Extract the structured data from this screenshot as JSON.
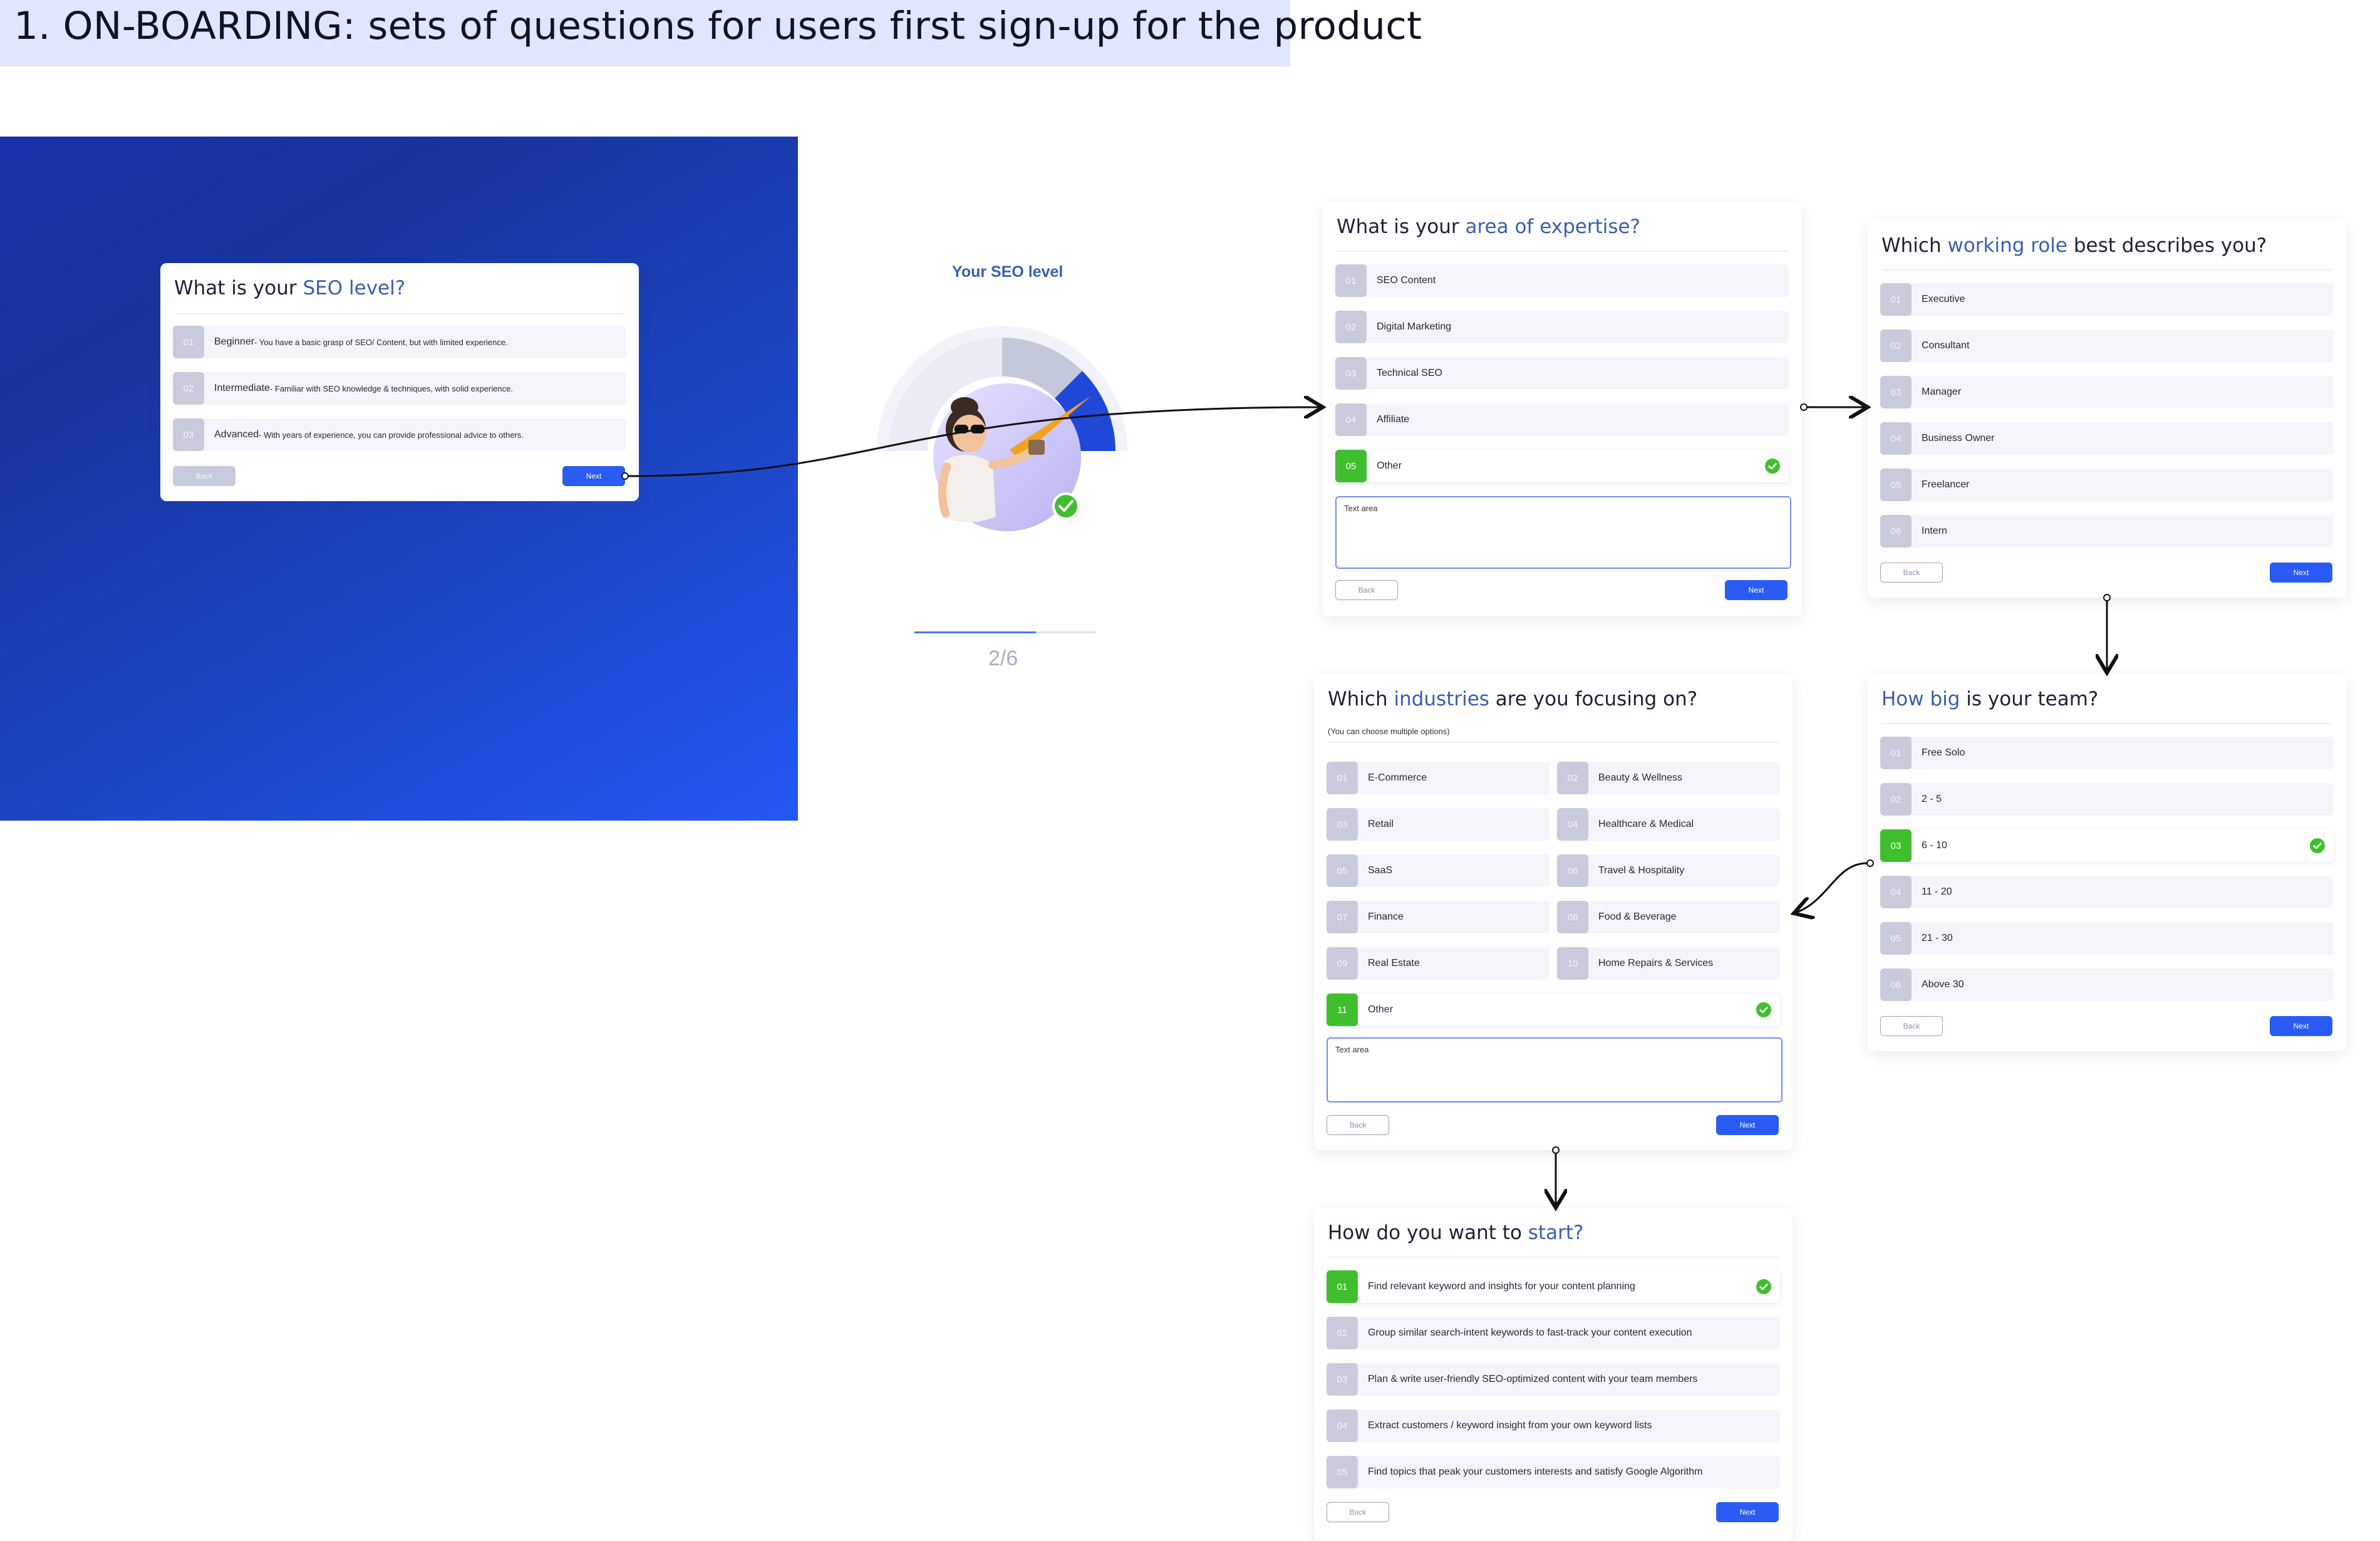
{
  "page_title": "1. ON-BOARDING: sets of questions for users first sign-up for the product",
  "seo_card": {
    "title_pre": "What is your ",
    "title_hl": "SEO level?",
    "options": [
      {
        "num": "01",
        "label": "Beginner",
        "desc": " - You have a basic grasp of SEO/ Content, but with limited experience."
      },
      {
        "num": "02",
        "label": "Intermediate",
        "desc": " - Familiar with SEO knowledge & techniques, with solid experience."
      },
      {
        "num": "03",
        "label": "Advanced",
        "desc": " - With years of experience, you can provide professional advice to others."
      }
    ],
    "back_label": "Back",
    "next_label": "Next"
  },
  "level_panel": {
    "title": "Your SEO level",
    "step": "2/6",
    "progress_fraction": 0.67
  },
  "expertise_card": {
    "title_pre": "What is your ",
    "title_hl": "area of expertise?",
    "options": [
      {
        "num": "01",
        "label": "SEO Content"
      },
      {
        "num": "02",
        "label": "Digital Marketing"
      },
      {
        "num": "03",
        "label": "Technical SEO"
      },
      {
        "num": "04",
        "label": "Affiliate"
      },
      {
        "num": "05",
        "label": "Other",
        "selected": true
      }
    ],
    "textarea_placeholder": "Text area",
    "back_label": "Back",
    "next_label": "Next"
  },
  "role_card": {
    "title_pre": "Which ",
    "title_hl": "working role",
    "title_post": " best describes you?",
    "options": [
      {
        "num": "01",
        "label": "Executive"
      },
      {
        "num": "02",
        "label": "Consultant"
      },
      {
        "num": "03",
        "label": "Manager"
      },
      {
        "num": "04",
        "label": "Business Owner"
      },
      {
        "num": "05",
        "label": "Freelancer"
      },
      {
        "num": "06",
        "label": "Intern"
      }
    ],
    "back_label": "Back",
    "next_label": "Next"
  },
  "team_card": {
    "title_hl": "How big",
    "title_post": " is your team?",
    "options": [
      {
        "num": "01",
        "label": "Free Solo"
      },
      {
        "num": "02",
        "label": "2 - 5"
      },
      {
        "num": "03",
        "label": "6 - 10",
        "selected": true
      },
      {
        "num": "04",
        "label": "11 - 20"
      },
      {
        "num": "05",
        "label": "21 - 30"
      },
      {
        "num": "06",
        "label": "Above 30"
      }
    ],
    "back_label": "Back",
    "next_label": "Next"
  },
  "industries_card": {
    "title_pre": "Which ",
    "title_hl": "industries",
    "title_post": " are you focusing on?",
    "subtitle": "(You can choose multiple options)",
    "options": [
      {
        "num": "01",
        "label": "E-Commerce"
      },
      {
        "num": "02",
        "label": "Beauty & Wellness"
      },
      {
        "num": "03",
        "label": "Retail"
      },
      {
        "num": "04",
        "label": "Healthcare & Medical"
      },
      {
        "num": "05",
        "label": "SaaS"
      },
      {
        "num": "06",
        "label": "Travel & Hospitality"
      },
      {
        "num": "07",
        "label": "Finance"
      },
      {
        "num": "08",
        "label": "Food & Beverage"
      },
      {
        "num": "09",
        "label": "Real Estate"
      },
      {
        "num": "10",
        "label": "Home Repairs & Services"
      },
      {
        "num": "11",
        "label": "Other",
        "selected": true
      }
    ],
    "textarea_placeholder": "Text area",
    "back_label": "Back",
    "next_label": "Next"
  },
  "start_card": {
    "title_pre": "How do you want to ",
    "title_hl": "start?",
    "options": [
      {
        "num": "01",
        "label": "Find relevant keyword and insights for your content planning",
        "selected": true
      },
      {
        "num": "02",
        "label": "Group similar search-intent keywords to fast-track your content execution"
      },
      {
        "num": "03",
        "label": "Plan & write user-friendly SEO-optimized content with your team members"
      },
      {
        "num": "04",
        "label": "Extract customers / keyword insight from your own keyword lists"
      },
      {
        "num": "05",
        "label": "Find topics that peak your customers interests and satisfy Google Algorithm"
      }
    ],
    "back_label": "Back",
    "next_label": "Next"
  },
  "colors": {
    "accent": "#2a5cf5",
    "highlight": "#3a5fb0",
    "selected": "#40bf2e",
    "option_bg": "#f4f5fa",
    "banner": "#dfe6fd"
  }
}
